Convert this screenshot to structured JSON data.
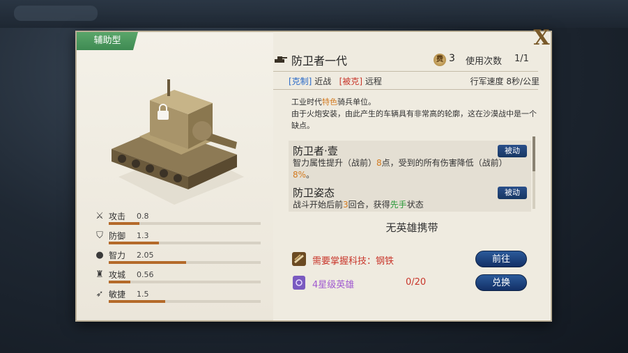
{
  "panel": {
    "type_tag": "辅助型",
    "close_label": "X"
  },
  "unit": {
    "name": "防卫者一代",
    "cost": "3",
    "cost_icon_text": "费",
    "use_label": "使用次数",
    "use_value": "1/1",
    "counter_label": "[克制]",
    "counter_value": "近战",
    "countered_label": "[被克]",
    "countered_value": "远程",
    "march_speed": "行军速度  8秒/公里",
    "desc_line1_a": "工业时代",
    "desc_line1_hl": "特色",
    "desc_line1_b": "骑兵单位。",
    "desc_line2": "由于火炮安装，由此产生的车辆具有非常高的轮廓，这在沙漠战中是一个缺点。"
  },
  "stats": [
    {
      "name": "攻击",
      "value": "0.8",
      "icon": "sword-icon",
      "fill": 0.2
    },
    {
      "name": "防御",
      "value": "1.3",
      "icon": "shield-icon",
      "fill": 0.33
    },
    {
      "name": "智力",
      "value": "2.05",
      "icon": "head-icon",
      "fill": 0.51
    },
    {
      "name": "攻城",
      "value": "0.56",
      "icon": "tower-icon",
      "fill": 0.14
    },
    {
      "name": "敏捷",
      "value": "1.5",
      "icon": "wing-icon",
      "fill": 0.37
    }
  ],
  "skills": [
    {
      "name": "防卫者·壹",
      "button": "被动",
      "desc_a": "智力属性提升（战前）",
      "desc_hl1": "8",
      "desc_b": "点，受到的所有伤害降低（战前）",
      "desc_hl2": "8%",
      "desc_c": "。"
    },
    {
      "name": "防卫姿态",
      "button": "被动",
      "desc_a": "战斗开始后前",
      "desc_hl1": "3",
      "desc_b": "回合，获得",
      "desc_hl2": "先手",
      "desc_c": "状态"
    }
  ],
  "hero": {
    "no_hero_text": "无英雄携带"
  },
  "requirements": [
    {
      "text": "需要掌握科技：钢铁",
      "count": "",
      "button": "前往",
      "icon": "tech-book-icon",
      "color": "#c8352a"
    },
    {
      "text": "4星级英雄",
      "count": "0/20",
      "button": "兑换",
      "icon": "hero-card-icon",
      "color": "#a05ad0"
    }
  ]
}
